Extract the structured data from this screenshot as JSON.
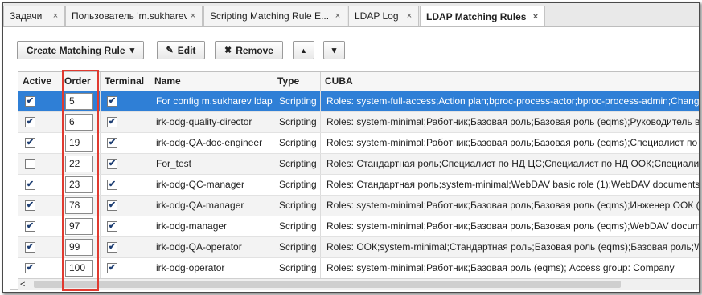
{
  "tabs": [
    {
      "label": "Задачи",
      "active": false
    },
    {
      "label": "Пользователь 'm.sukharev'",
      "active": false
    },
    {
      "label": "Scripting Matching Rule E...",
      "active": false
    },
    {
      "label": "LDAP Log",
      "active": false
    },
    {
      "label": "LDAP Matching Rules",
      "active": true
    }
  ],
  "tab_close_glyph": "×",
  "toolbar": {
    "create_label": "Create Matching Rule",
    "create_caret": "▾",
    "edit_label": "Edit",
    "remove_label": "Remove",
    "move_up_glyph": "▲",
    "move_down_glyph": "▾"
  },
  "columns": {
    "active": "Active",
    "order": "Order",
    "terminal": "Terminal",
    "name": "Name",
    "type": "Type",
    "cuba": "CUBA"
  },
  "rows": [
    {
      "active": true,
      "order": "5",
      "terminal": true,
      "name": "For config m.sukharev ldap",
      "type": "Scripting",
      "cuba": "Roles: system-full-access;Action plan;bproc-process-actor;bproc-process-admin;ChangePr",
      "selected": true
    },
    {
      "active": true,
      "order": "6",
      "terminal": true,
      "name": "irk-odg-quality-director",
      "type": "Scripting",
      "cuba": "Roles: system-minimal;Работник;Базовая роль;Базовая роль (eqms);Руководитель в об"
    },
    {
      "active": true,
      "order": "19",
      "terminal": true,
      "name": "irk-odg-QA-doc-engineer",
      "type": "Scripting",
      "cuba": "Roles: system-minimal;Работник;Базовая роль;Базовая роль (eqms);Специалист по до"
    },
    {
      "active": false,
      "order": "22",
      "terminal": true,
      "name": "For_test",
      "type": "Scripting",
      "cuba": "Roles: Стандартная роль;Специалист по НД ЦС;Специалист по НД ООК;Специалист"
    },
    {
      "active": true,
      "order": "23",
      "terminal": true,
      "name": "irk-odg-QC-manager",
      "type": "Scripting",
      "cuba": "Roles: Стандартная роль;system-minimal;WebDAV basic role (1);WebDAV documents rol"
    },
    {
      "active": true,
      "order": "78",
      "terminal": true,
      "name": "irk-odg-QA-manager",
      "type": "Scripting",
      "cuba": "Roles: system-minimal;Работник;Базовая роль;Базовая роль (eqms);Инженер ООК (eqm"
    },
    {
      "active": true,
      "order": "97",
      "terminal": true,
      "name": "irk-odg-manager",
      "type": "Scripting",
      "cuba": "Roles: system-minimal;Работник;Базовая роль;Базовая роль (eqms);WebDAV document"
    },
    {
      "active": true,
      "order": "99",
      "terminal": true,
      "name": "irk-odg-QA-operator",
      "type": "Scripting",
      "cuba": "Roles: ООК;system-minimal;Стандартная роль;Базовая роль (eqms);Базовая роль;Web"
    },
    {
      "active": true,
      "order": "100",
      "terminal": true,
      "name": "irk-odg-operator",
      "type": "Scripting",
      "cuba": "Roles: system-minimal;Работник;Базовая роль (eqms); Access group: Company"
    }
  ],
  "checkmark_glyph": "✔",
  "scroll_left_glyph": "<",
  "colors": {
    "selected_row": "#2f7fd6",
    "highlight_box": "#e03a30"
  }
}
